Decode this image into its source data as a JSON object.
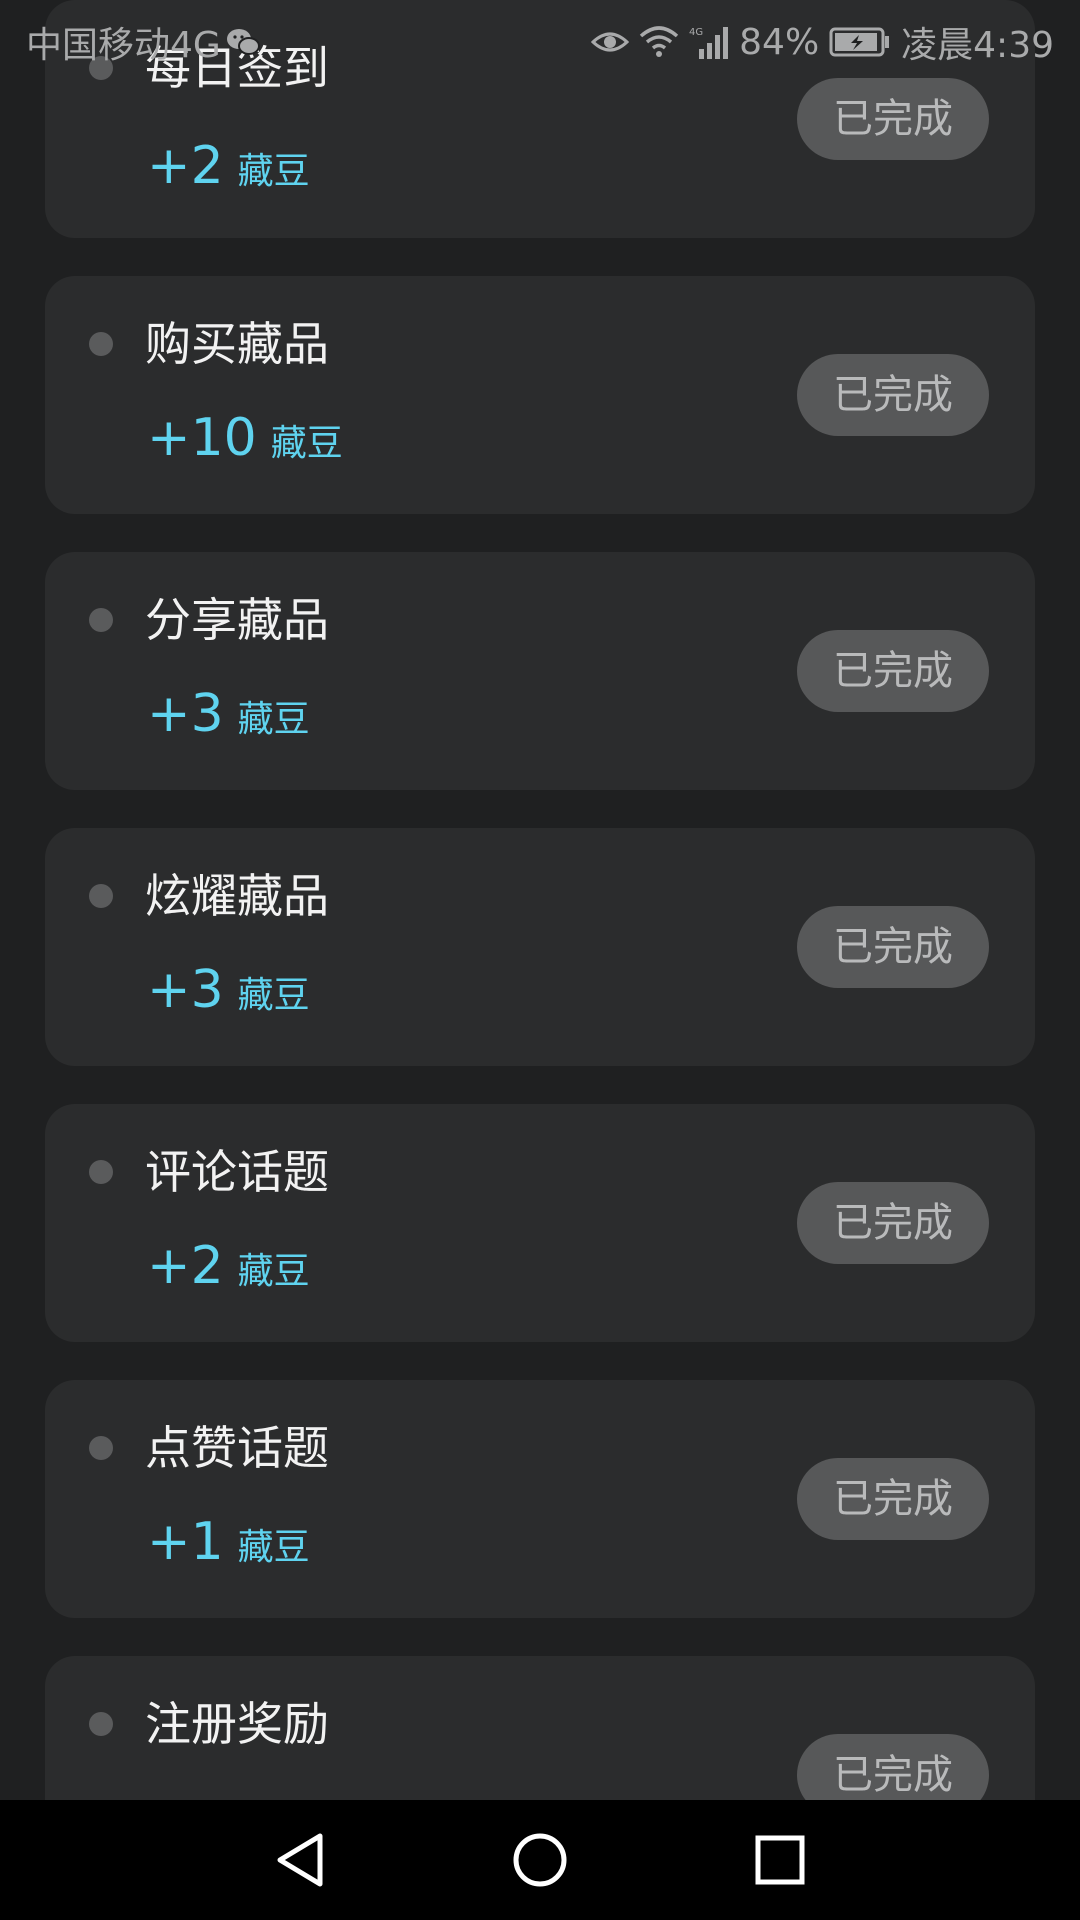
{
  "status_bar": {
    "carrier": "中国移动4G",
    "battery": "84%",
    "time": "凌晨4:39",
    "icons": [
      "wechat-icon",
      "eye-icon",
      "wifi-icon",
      "signal-icon",
      "battery-icon"
    ]
  },
  "tasks": [
    {
      "title": "每日签到",
      "amount": "+2",
      "unit": "藏豆",
      "status": "已完成"
    },
    {
      "title": "购买藏品",
      "amount": "+10",
      "unit": "藏豆",
      "status": "已完成"
    },
    {
      "title": "分享藏品",
      "amount": "+3",
      "unit": "藏豆",
      "status": "已完成"
    },
    {
      "title": "炫耀藏品",
      "amount": "+3",
      "unit": "藏豆",
      "status": "已完成"
    },
    {
      "title": "评论话题",
      "amount": "+2",
      "unit": "藏豆",
      "status": "已完成"
    },
    {
      "title": "点赞话题",
      "amount": "+1",
      "unit": "藏豆",
      "status": "已完成"
    },
    {
      "title": "注册奖励",
      "amount": "",
      "unit": "",
      "status": "已完成"
    }
  ],
  "nav": {
    "icons": [
      "back-icon",
      "home-icon",
      "recents-icon"
    ]
  },
  "colors": {
    "background": "#1f2021",
    "card": "#2b2c2d",
    "reward": "#5fd3ef",
    "button": "#575859"
  }
}
